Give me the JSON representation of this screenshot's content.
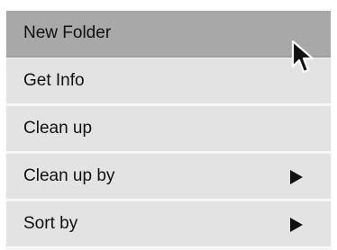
{
  "context_menu": {
    "items": [
      {
        "label": "New Folder",
        "state": "highlighted",
        "has_submenu": false
      },
      {
        "label": "Get Info",
        "state": "normal",
        "has_submenu": false
      },
      {
        "label": "Clean up",
        "state": "normal",
        "has_submenu": false
      },
      {
        "label": "Clean up by",
        "state": "normal",
        "has_submenu": true
      },
      {
        "label": "Sort by",
        "state": "normal",
        "has_submenu": true
      }
    ]
  },
  "icons": {
    "pointer": "mouse-pointer-icon",
    "submenu": "triangle-right-icon"
  },
  "colors": {
    "item_background": "#e3e3e3",
    "highlight_background": "#a8a8a8",
    "separator": "#f8f8f8",
    "text": "#111111"
  }
}
